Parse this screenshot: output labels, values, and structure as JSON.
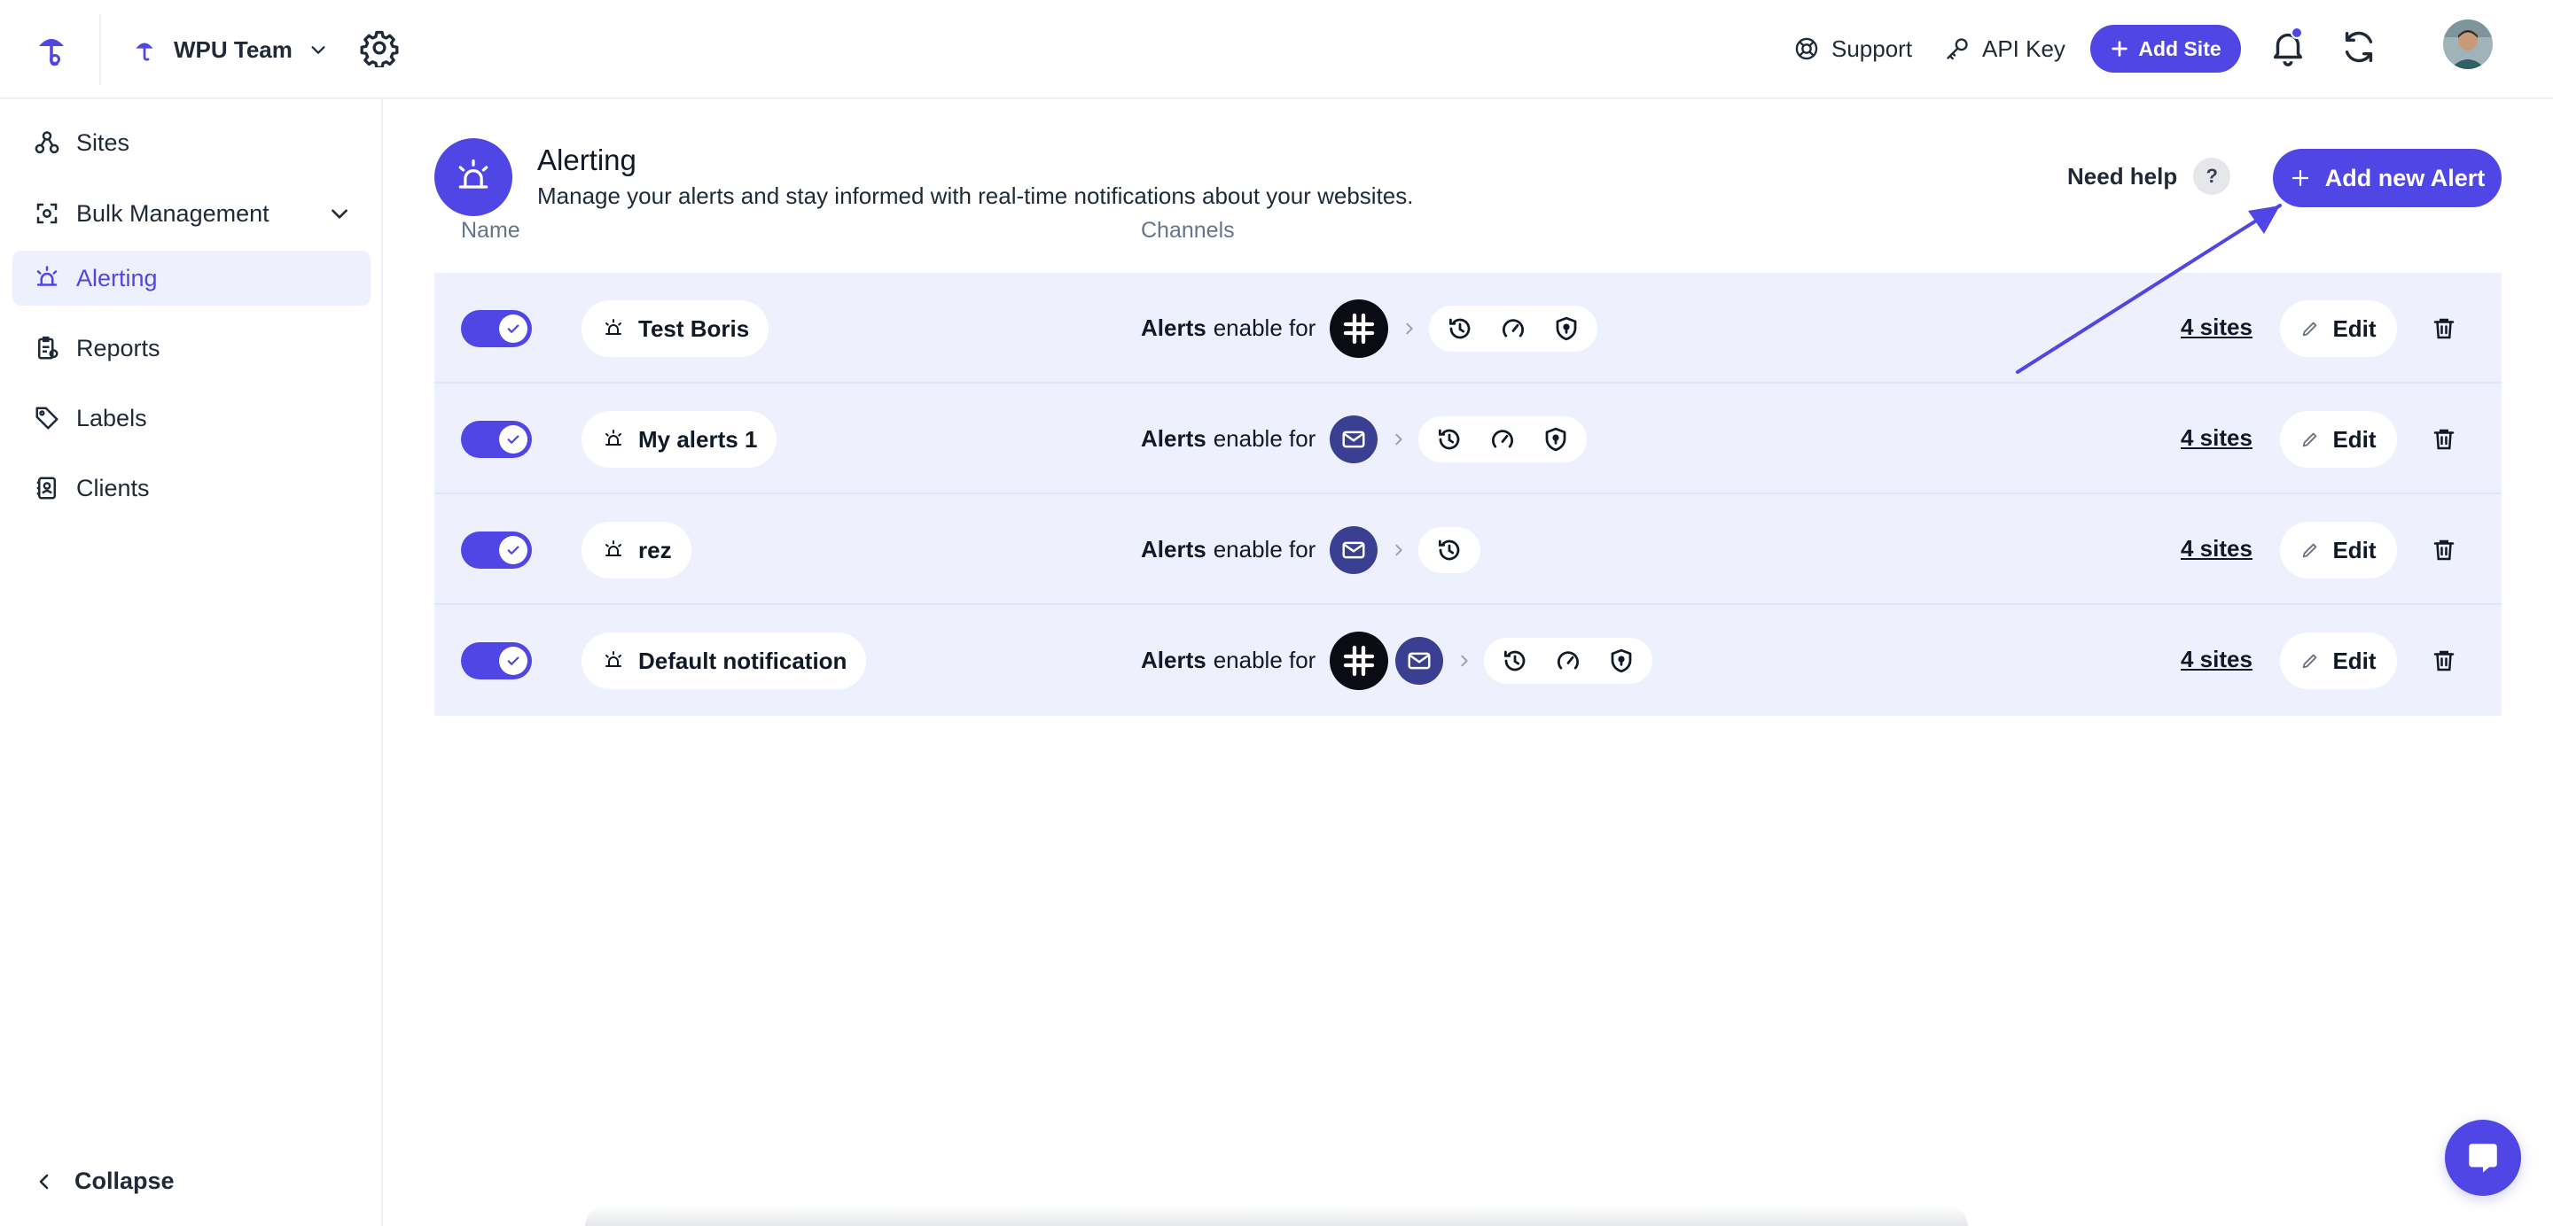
{
  "topbar": {
    "team_name": "WPU Team",
    "support_label": "Support",
    "api_key_label": "API Key",
    "add_site_label": "Add Site",
    "notification_badge": true
  },
  "sidebar": {
    "items": [
      {
        "label": "Sites",
        "icon": "sites-icon",
        "active": false
      },
      {
        "label": "Bulk Management",
        "icon": "bulk-management-icon",
        "active": false,
        "has_submenu": true
      },
      {
        "label": "Alerting",
        "icon": "alert-siren-icon",
        "active": true
      },
      {
        "label": "Reports",
        "icon": "reports-icon",
        "active": false
      },
      {
        "label": "Labels",
        "icon": "tag-icon",
        "active": false
      },
      {
        "label": "Clients",
        "icon": "contacts-icon",
        "active": false
      }
    ],
    "collapse_label": "Collapse"
  },
  "page": {
    "title": "Alerting",
    "subtitle": "Manage your alerts and stay informed with real-time notifications about your websites.",
    "need_help_label": "Need help",
    "help_mark": "?",
    "add_alert_label": "Add new Alert"
  },
  "table": {
    "columns": {
      "name": "Name",
      "channels": "Channels"
    },
    "alerts_word": "Alerts",
    "enable_for_text": "enable for",
    "edit_label": "Edit",
    "rows": [
      {
        "name": "Test Boris",
        "enabled": true,
        "channels": [
          "slack"
        ],
        "alert_types": [
          "history",
          "performance",
          "security"
        ],
        "sites": "4 sites"
      },
      {
        "name": "My alerts 1",
        "enabled": true,
        "channels": [
          "email"
        ],
        "alert_types": [
          "history",
          "performance",
          "security"
        ],
        "sites": "4 sites"
      },
      {
        "name": "rez",
        "enabled": true,
        "channels": [
          "email"
        ],
        "alert_types": [
          "history"
        ],
        "sites": "4 sites"
      },
      {
        "name": "Default notification",
        "enabled": true,
        "channels": [
          "slack",
          "email"
        ],
        "alert_types": [
          "history",
          "performance",
          "security"
        ],
        "sites": "4 sites"
      }
    ]
  },
  "colors": {
    "accent": "#4f46e5",
    "row_background": "#eef1fd",
    "email_channel": "#3b3f91",
    "slack_channel": "#0b0b14"
  }
}
